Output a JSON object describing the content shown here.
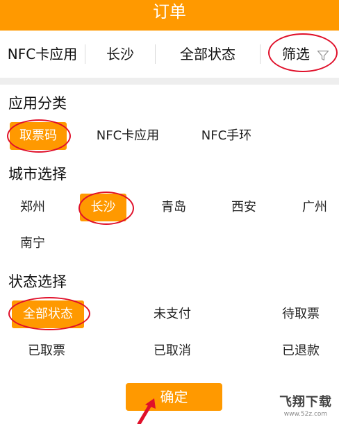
{
  "header": {
    "title": "订单"
  },
  "filter_bar": {
    "items": [
      "NFC卡应用",
      "长沙",
      "全部状态",
      "筛选"
    ],
    "filter_icon": "funnel-icon"
  },
  "sections": {
    "category": {
      "title": "应用分类",
      "options": [
        "取票码",
        "NFC卡应用",
        "NFC手环"
      ],
      "selected": "取票码"
    },
    "city": {
      "title": "城市选择",
      "options": [
        "郑州",
        "长沙",
        "青岛",
        "西安",
        "广州",
        "南宁"
      ],
      "selected": "长沙"
    },
    "status": {
      "title": "状态选择",
      "options": [
        "全部状态",
        "未支付",
        "待取票",
        "已取票",
        "已取消",
        "已退款"
      ],
      "selected": "全部状态"
    }
  },
  "confirm_label": "确定",
  "watermark": {
    "main": "飞翔下载",
    "sub": "www.52z.com"
  },
  "colors": {
    "accent": "#FF9900",
    "annotation_red": "#e0102a",
    "divider_band": "#eeeeee"
  }
}
